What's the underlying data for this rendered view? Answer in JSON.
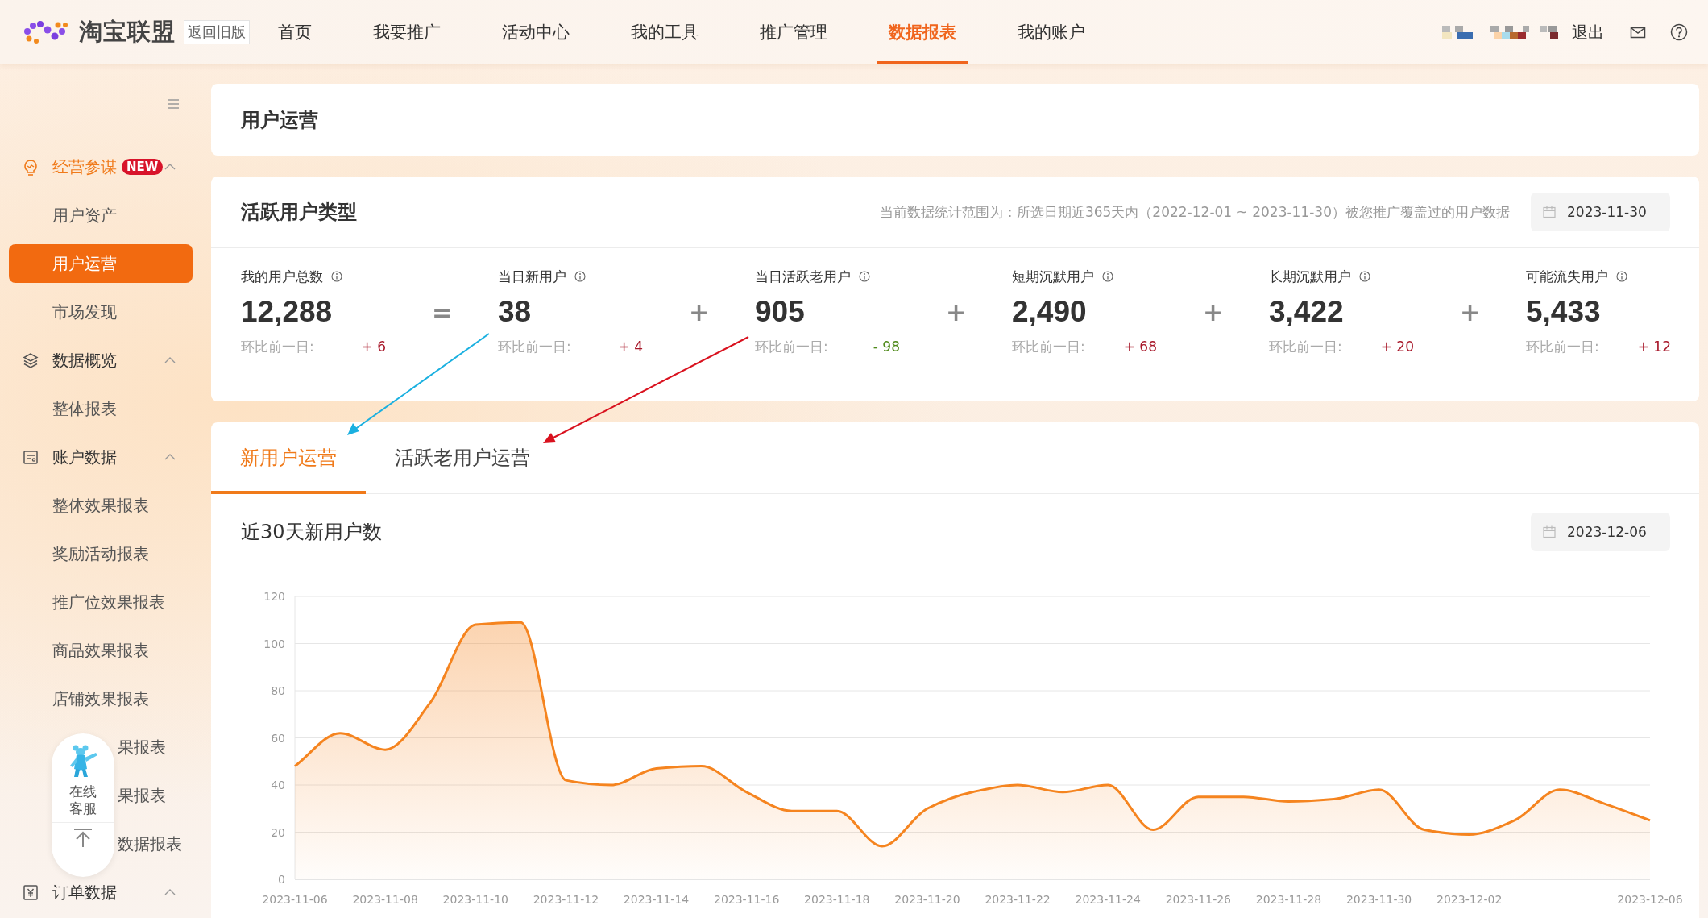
{
  "header": {
    "logo_text": "淘宝联盟",
    "old_version": "返回旧版",
    "nav": [
      {
        "label": "首页",
        "selected": false
      },
      {
        "label": "我要推广",
        "selected": false
      },
      {
        "label": "活动中心",
        "selected": false
      },
      {
        "label": "我的工具",
        "selected": false
      },
      {
        "label": "推广管理",
        "selected": false
      },
      {
        "label": "数据报表",
        "selected": true
      },
      {
        "label": "我的账户",
        "selected": false
      }
    ],
    "logout": "退出"
  },
  "sidebar": {
    "groups": [
      {
        "label": "经营参谋",
        "kind": "bulb",
        "badge": "NEW",
        "highlighted": true,
        "expanded": true,
        "items": [
          {
            "label": "用户资产",
            "selected": false,
            "kind": "plain"
          },
          {
            "label": "用户运营",
            "selected": true,
            "kind": "plain"
          },
          {
            "label": "市场发现",
            "selected": false,
            "kind": "plain"
          }
        ]
      },
      {
        "label": "数据概览",
        "kind": "layers",
        "highlighted": false,
        "expanded": true,
        "items": [
          {
            "label": "整体报表",
            "selected": false,
            "kind": "plain"
          }
        ]
      },
      {
        "label": "账户数据",
        "kind": "card",
        "highlighted": false,
        "expanded": true,
        "items": [
          {
            "label": "整体效果报表",
            "selected": false,
            "kind": "plain"
          },
          {
            "label": "奖励活动报表",
            "selected": false,
            "kind": "plain"
          },
          {
            "label": "推广位效果报表",
            "selected": false,
            "kind": "plain"
          },
          {
            "label": "商品效果报表",
            "selected": false,
            "kind": "plain"
          },
          {
            "label": "店铺效果报表",
            "selected": false,
            "kind": "plain"
          },
          {
            "label": "果报表",
            "selected": false,
            "kind": "covered"
          },
          {
            "label": "果报表",
            "selected": false,
            "kind": "covered"
          },
          {
            "label": "数据报表",
            "selected": false,
            "kind": "covered"
          }
        ]
      },
      {
        "label": "订单数据",
        "kind": "yen",
        "highlighted": false,
        "expanded": true
      }
    ]
  },
  "help_widget": {
    "label": "在线客服"
  },
  "page_title": "用户运营",
  "user_types": {
    "title": "活跃用户类型",
    "note": "当前数据统计范围为：所选日期近365天内（2022-12-01 ~ 2023-11-30）被您推广覆盖过的用户数据",
    "date": "2023-11-30",
    "metrics": [
      {
        "label": "我的用户总数",
        "value": "12,288",
        "compare_label": "环比前一日:",
        "change": "+ 6",
        "color": "#a8182a",
        "operator": "="
      },
      {
        "label": "当日新用户",
        "value": "38",
        "compare_label": "环比前一日:",
        "change": "+ 4",
        "color": "#a8182a",
        "operator": "+"
      },
      {
        "label": "当日活跃老用户",
        "value": "905",
        "compare_label": "环比前一日:",
        "change": "- 98",
        "color": "#4f8a1a",
        "operator": "+"
      },
      {
        "label": "短期沉默用户",
        "value": "2,490",
        "compare_label": "环比前一日:",
        "change": "+ 68",
        "color": "#a8182a",
        "operator": "+"
      },
      {
        "label": "长期沉默用户",
        "value": "3,422",
        "compare_label": "环比前一日:",
        "change": "+ 20",
        "color": "#a8182a",
        "operator": "+"
      },
      {
        "label": "可能流失用户",
        "value": "5,433",
        "compare_label": "环比前一日:",
        "change": "+ 12",
        "color": "#a8182a"
      }
    ]
  },
  "tabs": [
    {
      "label": "新用户运营",
      "selected": true
    },
    {
      "label": "活跃老用户运营",
      "selected": false
    }
  ],
  "chart_date": "2023-12-06",
  "chart_data": {
    "type": "area",
    "title": "近30天新用户数",
    "categories": [
      "2023-11-06",
      null,
      "2023-11-08",
      null,
      "2023-11-10",
      null,
      "2023-11-12",
      null,
      "2023-11-14",
      null,
      "2023-11-16",
      null,
      "2023-11-18",
      null,
      "2023-11-20",
      null,
      "2023-11-22",
      null,
      "2023-11-24",
      null,
      "2023-11-26",
      null,
      "2023-11-28",
      null,
      "2023-11-30",
      null,
      "2023-12-02",
      null,
      null,
      null,
      "2023-12-06"
    ],
    "series": [
      {
        "color": "#f5841f",
        "values": [
          48,
          62,
          55,
          75,
          108,
          109,
          42,
          40,
          47,
          48,
          37,
          29,
          29,
          14,
          30,
          37,
          40,
          37,
          40,
          21,
          35,
          35,
          33,
          34,
          38,
          21,
          19,
          25,
          38,
          32,
          25
        ]
      }
    ],
    "ylim": [
      0,
      120
    ],
    "yticks": [
      0,
      20,
      40,
      60,
      80,
      100,
      120
    ],
    "grid": true
  }
}
